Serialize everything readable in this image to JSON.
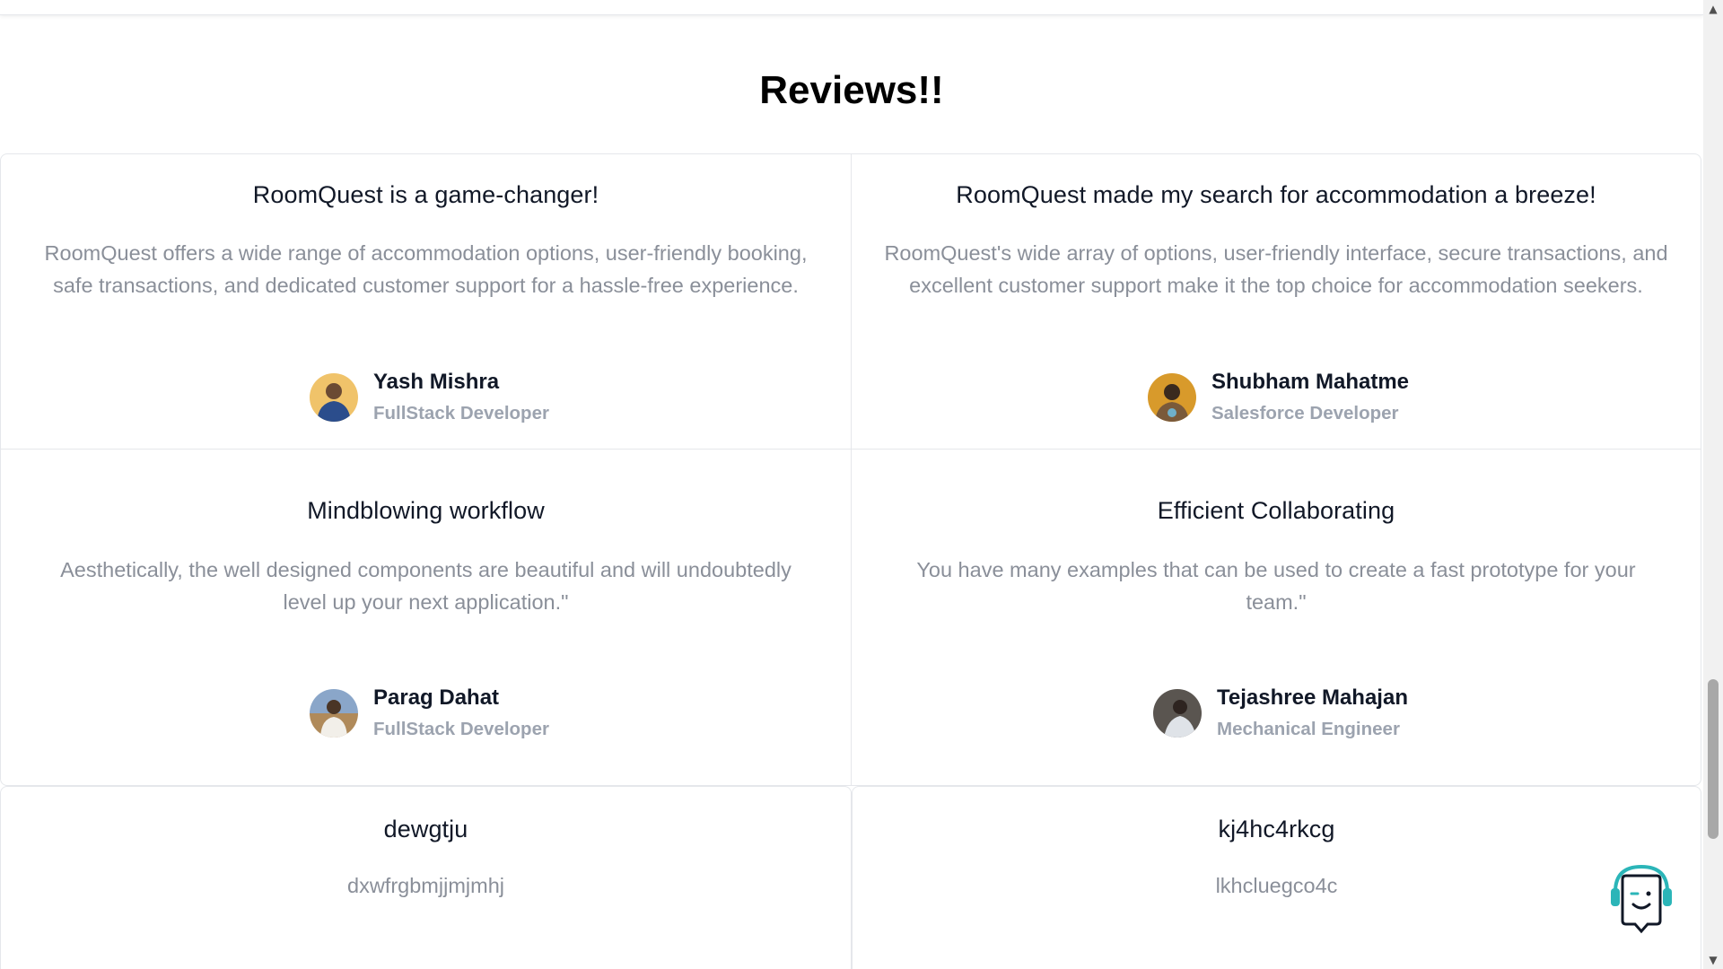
{
  "section": {
    "title": "Reviews!!"
  },
  "reviews": [
    {
      "title": "RoomQuest is a game-changer!",
      "text_line1": "RoomQuest offers a wide range of accommodation options, user-friendly booking,",
      "text_line2": "safe transactions, and dedicated customer support for a hassle-free experience.",
      "author_name": "Yash Mishra",
      "author_role": "FullStack Developer",
      "avatar_icon": "avatar-photo-icon",
      "avatar_colors": [
        "#f0c36a",
        "#2b4d8c"
      ]
    },
    {
      "title": "RoomQuest made my search for accommodation a breeze!",
      "text_line1": "RoomQuest's wide array of options, user-friendly interface, secure transactions, and",
      "text_line2": "excellent customer support make it the top choice for accommodation seekers.",
      "author_name": "Shubham Mahatme",
      "author_role": "Salesforce Developer",
      "avatar_icon": "avatar-photo-icon",
      "avatar_colors": [
        "#d89a2b",
        "#3a2a1e"
      ]
    },
    {
      "title": "Mindblowing workflow",
      "text_line1": "Aesthetically, the well designed components are beautiful and will undoubtedly",
      "text_line2": "level up your next application.\"",
      "author_name": "Parag Dahat",
      "author_role": "FullStack Developer",
      "avatar_icon": "avatar-photo-icon",
      "avatar_colors": [
        "#8aa6c9",
        "#f2efe9"
      ]
    },
    {
      "title": "Efficient Collaborating",
      "text_line1": "You have many examples that can be used to create a fast prototype for your",
      "text_line2": "team.\"",
      "author_name": "Tejashree Mahajan",
      "author_role": "Mechanical Engineer",
      "avatar_icon": "avatar-photo-icon",
      "avatar_colors": [
        "#5a5550",
        "#dfe3e8"
      ]
    },
    {
      "title": "dewgtju",
      "text_line1": "dxwfrgbmjjmjmhj"
    },
    {
      "title": "kj4hc4rkcg",
      "text_line1": "lkhcluegco4c"
    }
  ],
  "colors": {
    "border": "#e5e7eb",
    "muted_text": "#8a8f99",
    "role_text": "#9ca3af",
    "chat_accent": "#2bb5b8"
  },
  "chat_widget": {
    "icon": "support-chat-robot-icon"
  }
}
